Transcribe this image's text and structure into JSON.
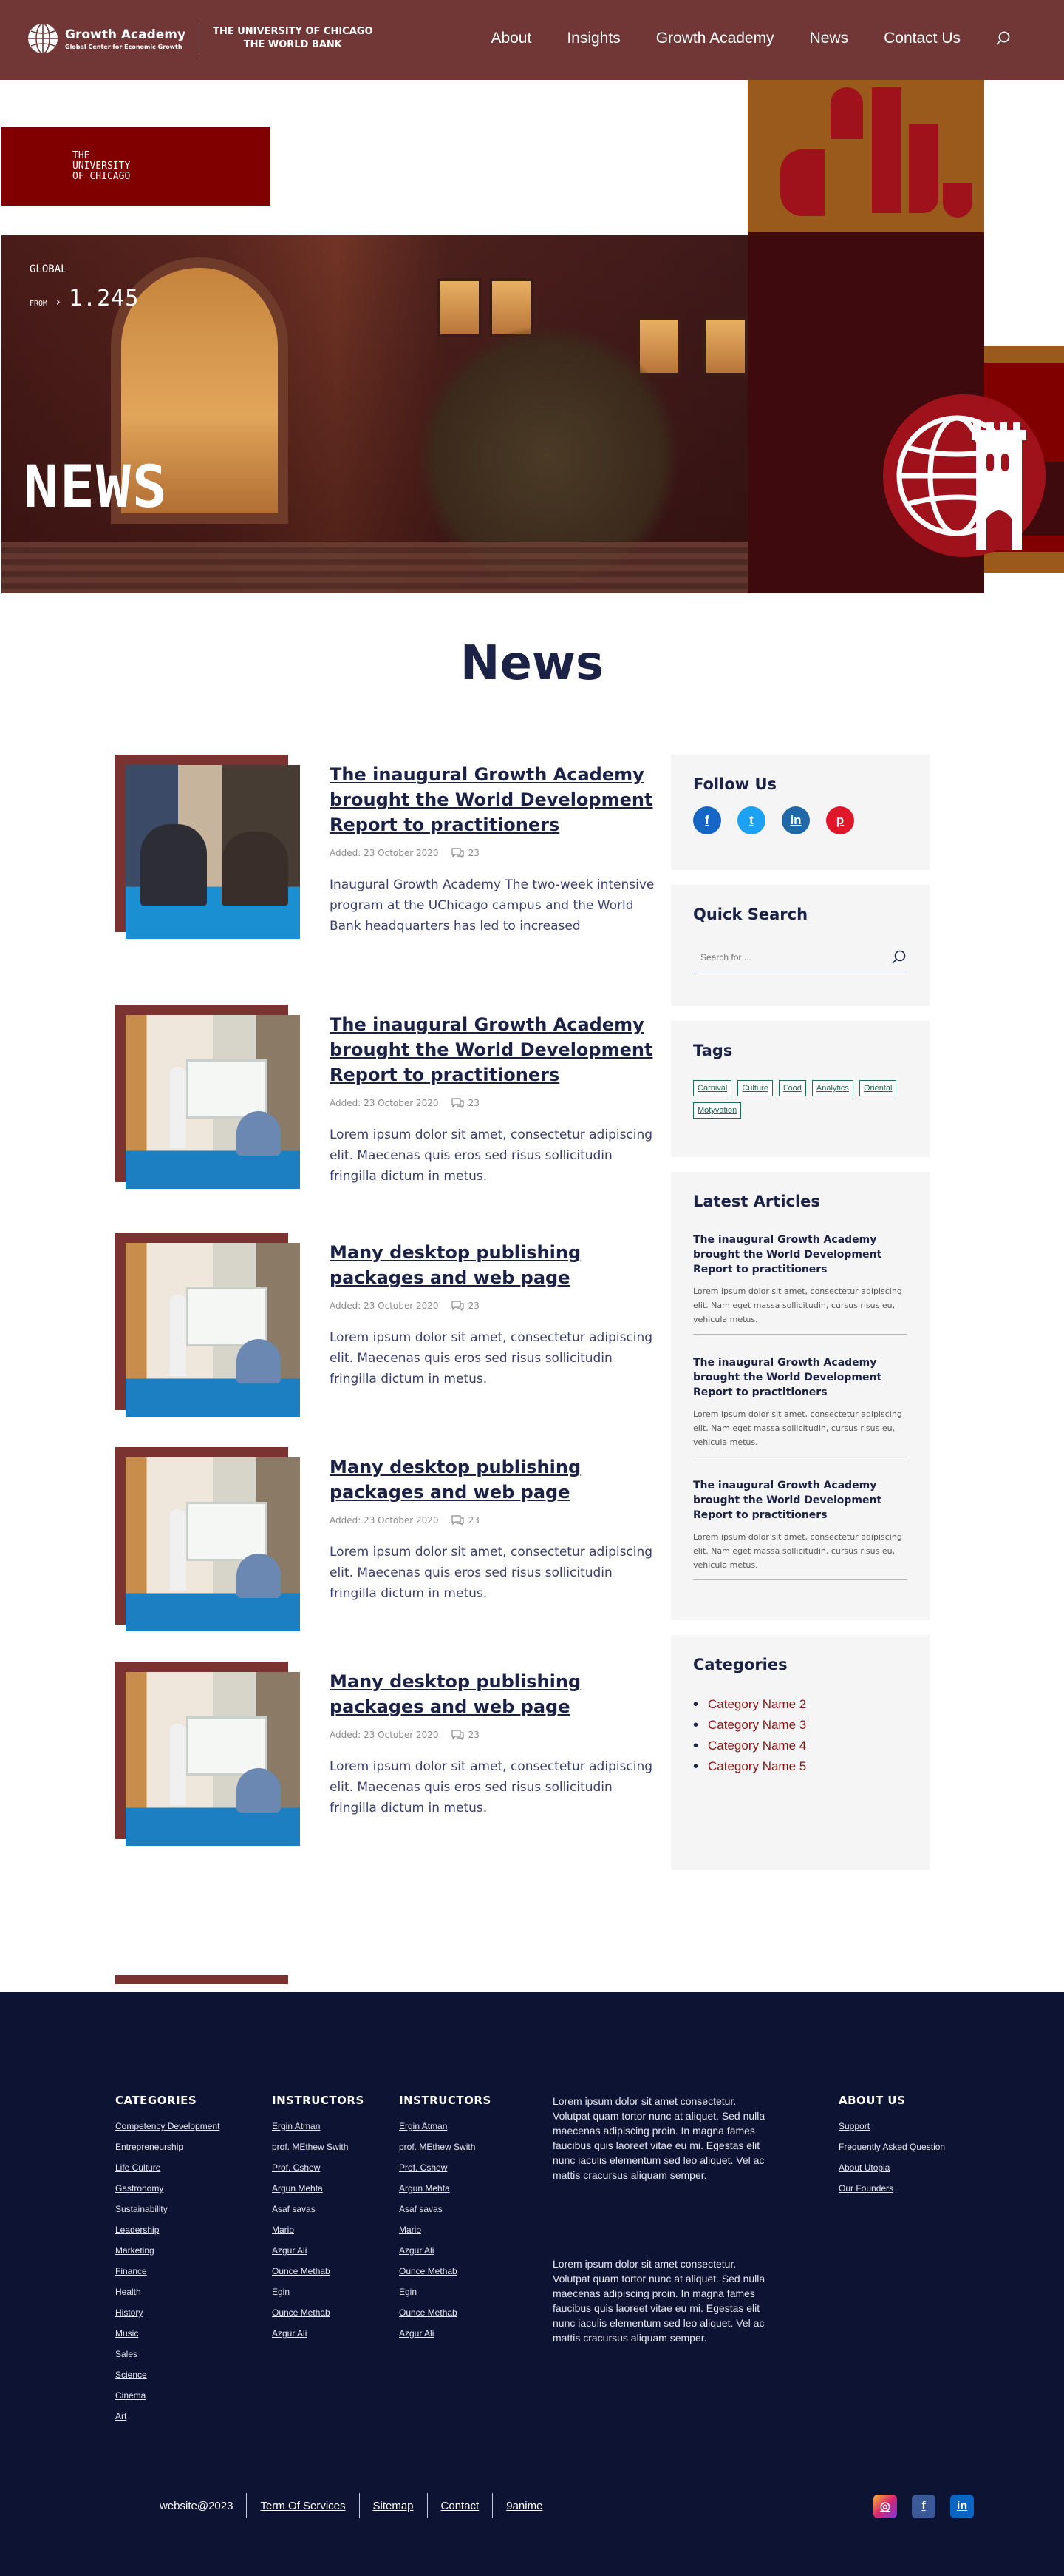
{
  "header": {
    "brand_title": "Growth Academy",
    "brand_sub": "Global Center for Economic Growth",
    "partner_line1": "THE UNIVERSITY OF CHICAGO",
    "partner_line2": "THE WORLD BANK",
    "nav": [
      "About",
      "Insights",
      "Growth Academy",
      "News",
      "Contact Us"
    ]
  },
  "hero": {
    "badge_line1": "THE",
    "badge_line2": "UNIVERSITY",
    "badge_line3": "OF CHICAGO",
    "global_label": "GLOBAL",
    "from_label": "FROM",
    "from_number": "1.245",
    "headline": "NEWS"
  },
  "page_title": "News",
  "posts": [
    {
      "title": "The inaugural Growth Academy brought the World Development Report to practitioners",
      "date": "Added: 23 October 2020",
      "comments": "23",
      "excerpt": "Inaugural Growth Academy The two-week intensive program at the UChicago campus and the World Bank headquarters has led to increased"
    },
    {
      "title": "The inaugural Growth Academy brought the World Development Report to practitioners",
      "date": "Added: 23 October 2020",
      "comments": "23",
      "excerpt": "Lorem ipsum dolor sit amet, consectetur adipiscing elit. Maecenas quis eros sed risus sollicitudin fringilla dictum in metus."
    },
    {
      "title": "Many desktop publishing packages and web page",
      "date": "Added: 23 October 2020",
      "comments": "23",
      "excerpt": "Lorem ipsum dolor sit amet, consectetur adipiscing elit. Maecenas quis eros sed risus sollicitudin fringilla dictum in metus."
    },
    {
      "title": "Many desktop publishing packages and web page",
      "date": "Added: 23 October 2020",
      "comments": "23",
      "excerpt": "Lorem ipsum dolor sit amet, consectetur adipiscing elit. Maecenas quis eros sed risus sollicitudin fringilla dictum in metus."
    },
    {
      "title": "Many desktop publishing packages and web page",
      "date": "Added: 23 October 2020",
      "comments": "23",
      "excerpt": "Lorem ipsum dolor sit amet, consectetur adipiscing elit. Maecenas quis eros sed risus sollicitudin fringilla dictum in metus."
    }
  ],
  "sidebar": {
    "follow_title": "Follow Us",
    "social": [
      {
        "icon": "facebook-icon",
        "glyph": "f",
        "color": "#1666c5"
      },
      {
        "icon": "twitter-icon",
        "glyph": "t",
        "color": "#1da1f2"
      },
      {
        "icon": "linkedin-icon",
        "glyph": "in",
        "color": "#1f6aa6"
      },
      {
        "icon": "pinterest-icon",
        "glyph": "p",
        "color": "#e0162b"
      }
    ],
    "search_title": "Quick Search",
    "search_placeholder": "Search for ...",
    "tags_title": "Tags",
    "tags": [
      "Carnival",
      "Culture",
      "Food",
      "Analytics",
      "Oriental",
      "Motyvation"
    ],
    "latest_title": "Latest Articles",
    "latest": [
      {
        "title": "The inaugural Growth Academy brought the World Development Report to practitioners",
        "text": "Lorem ipsum dolor sit amet, consectetur adipiscing elit. Nam eget massa sollicitudin, cursus risus eu, vehicula metus."
      },
      {
        "title": "The inaugural Growth Academy brought the World Development Report to practitioners",
        "text": "Lorem ipsum dolor sit amet, consectetur adipiscing elit. Nam eget massa sollicitudin, cursus risus eu, vehicula metus."
      },
      {
        "title": "The inaugural Growth Academy brought the World Development Report to practitioners",
        "text": "Lorem ipsum dolor sit amet, consectetur adipiscing elit. Nam eget massa sollicitudin, cursus risus eu, vehicula metus."
      }
    ],
    "categories_title": "Categories",
    "categories": [
      "Category Name 2",
      "Category Name 3",
      "Category Name 4",
      "Category Name 5"
    ]
  },
  "footer": {
    "categories_title": "CATEGORIES",
    "categories": [
      "Competency Development",
      "Entrepreneurship",
      "Life Culture",
      "Gastronomy",
      "Sustainability",
      "Leadership",
      "Marketing",
      "Finance",
      "Health",
      "History",
      "Music",
      "Sales",
      "Science",
      "Cinema",
      "Art"
    ],
    "instructors_title": "INSTRUCTORS",
    "instructors": [
      "Ergin Atman",
      "prof. MEthew Swith",
      "Prof. Cshew",
      "Argun  Mehta",
      "Asaf savas",
      "Mario",
      "Azgur Ali",
      "Ounce Methab",
      "Egin",
      "Ounce Methab",
      "Azgur Ali"
    ],
    "instructors2_title": "INSTRUCTORS",
    "instructors2": [
      "Ergin Atman",
      "prof. MEthew Swith",
      "Prof. Cshew",
      "Argun  Mehta",
      "Asaf savas",
      "Mario",
      "Azgur Ali",
      "Ounce Methab",
      "Egin",
      "Ounce Methab",
      "Azgur Ali"
    ],
    "text1": "Lorem ipsum dolor sit amet consectetur. Volutpat quam tortor nunc at aliquet. Sed nulla maecenas adipiscing proin. In magna fames faucibus quis laoreet vitae eu mi. Egestas elit nunc iaculis elementum sed leo aliquet. Vel ac mattis cracursus  aliquam semper.",
    "text2": "Lorem ipsum dolor sit amet consectetur. Volutpat quam tortor nunc at aliquet. Sed nulla maecenas adipiscing proin. In magna fames faucibus quis laoreet vitae eu mi. Egestas elit nunc iaculis elementum sed leo aliquet. Vel ac mattis cracursus  aliquam semper.",
    "about_title": "ABOUT US",
    "about": [
      "Support",
      "Frequently Asked Question",
      "About  Utopia",
      "Our Founders"
    ],
    "bottom_links": [
      "website@2023",
      "Term Of Services",
      "Sitemap",
      "Contact",
      "9anime"
    ],
    "social": [
      {
        "icon": "instagram-icon",
        "glyph": "◎",
        "color": "#d6266f"
      },
      {
        "icon": "facebook-icon",
        "glyph": "f",
        "color": "#3b5998"
      },
      {
        "icon": "linkedin-icon",
        "glyph": "in",
        "color": "#0a66c2"
      }
    ]
  }
}
